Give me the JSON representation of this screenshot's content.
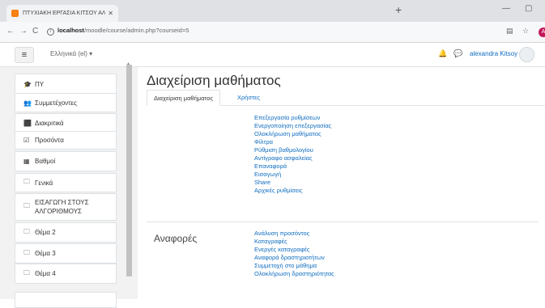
{
  "browser": {
    "tab_title": "ΠΤΥΧΙΑΚΗ ΕΡΓΑΣΙΑ ΚΙΤΣΟΥ ΑΛΕΞ",
    "url_host": "localhost",
    "url_path": "/moodle/course/admin.php?courseid=5",
    "profile_initial": "A"
  },
  "navbar": {
    "menu_glyph": "≡",
    "language": "Ελληνικά (el) ▾",
    "username": "alexandra Kitsoy"
  },
  "drawer": {
    "items": [
      {
        "icon": "graduation-cap-icon",
        "glyph": "🎓",
        "label": "ΠΥ"
      },
      {
        "icon": "users-icon",
        "glyph": "👥",
        "label": "Συμμετέχοντες"
      },
      {
        "icon": "shield-icon",
        "glyph": "⬛",
        "label": "Διακριτικά"
      },
      {
        "icon": "checkbox-icon",
        "glyph": "☑",
        "label": "Προσόντα"
      },
      {
        "icon": "grid-icon",
        "glyph": "▦",
        "label": "Βαθμοί"
      },
      {
        "icon": "folder-icon",
        "glyph": "🗀",
        "label": "Γενικά"
      },
      {
        "icon": "folder-icon",
        "glyph": "🗀",
        "label": "ΕΙΣΑΓΩΓΗ ΣΤΟΥΣ ΑΛΓΟΡΙΘΜΟΥΣ"
      },
      {
        "icon": "folder-icon",
        "glyph": "🗀",
        "label": "Θέμα 2"
      },
      {
        "icon": "folder-icon",
        "glyph": "🗀",
        "label": "Θέμα 3"
      },
      {
        "icon": "folder-icon",
        "glyph": "🗀",
        "label": "Θέμα 4"
      }
    ]
  },
  "main": {
    "page_title": "Διαχείριση μαθήματος",
    "tabs": [
      {
        "label": "Διαχείριση μαθήματος",
        "active": true
      },
      {
        "label": "Χρήστες",
        "active": false
      }
    ],
    "course_links": [
      "Επεξεργασία ρυθμίσεων",
      "Ενεργοποίηση επεξεργασίας",
      "Ολοκλήρωση μαθήματος",
      "Φίλτρα",
      "Ρύθμιση βαθμολογίου",
      "Αντίγραφο ασφαλείας",
      "Επαναφορά",
      "Εισαγωγή",
      "Share",
      "Αρχικές ρυθμίσεις"
    ],
    "reports_label": "Αναφορές",
    "report_links": [
      "Ανάλυση προσόντος",
      "Καταγραφές",
      "Ενεργές καταγραφές",
      "Αναφορά δραστηριοτήτων",
      "Συμμετοχή στο μάθημα",
      "Ολοκλήρωση δραστηριότητας"
    ]
  },
  "colors": {
    "link": "#0f6cbf",
    "drawer_bg": "#f2f2f2",
    "favicon": "#f98012"
  }
}
